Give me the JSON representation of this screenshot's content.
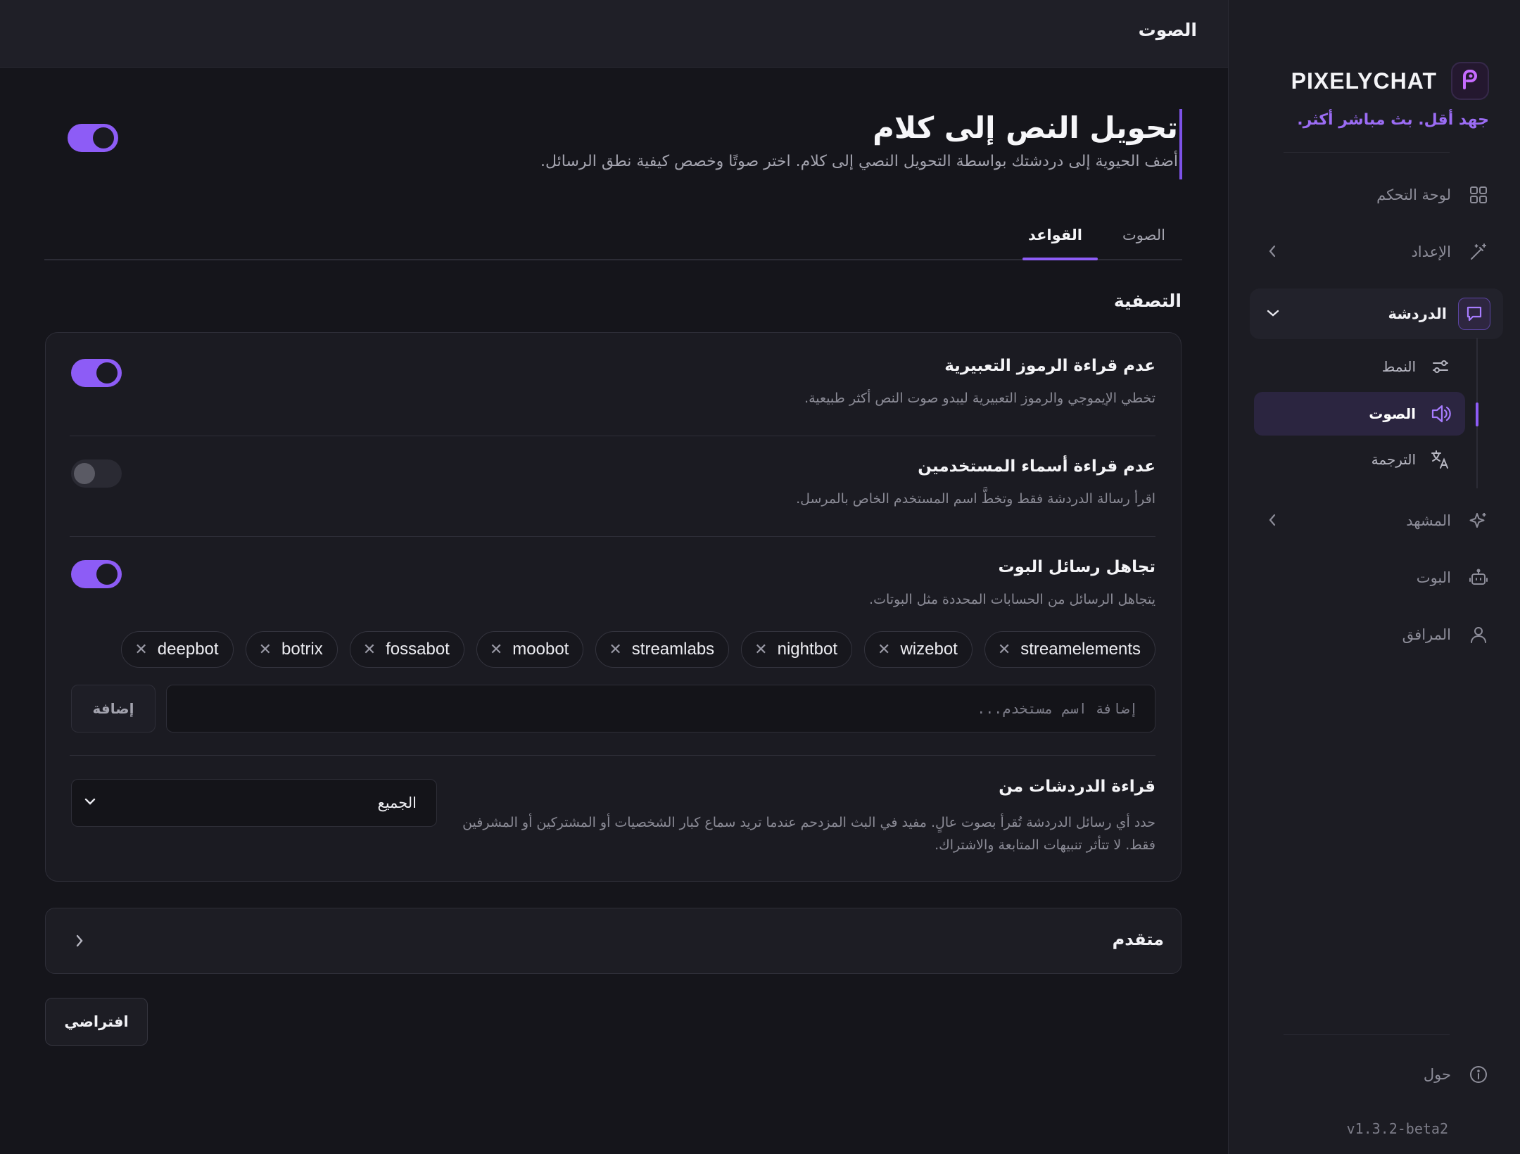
{
  "sidebar": {
    "brand": "PIXELYCHAT",
    "tagline": "جهد أقل. بث مباشر أكثر.",
    "items": [
      {
        "label": "لوحة التحكم",
        "icon": "grid-icon"
      },
      {
        "label": "الإعداد",
        "icon": "magic-wand-icon"
      },
      {
        "label": "الدردشة",
        "icon": "chat-bubble-icon"
      },
      {
        "label": "المشهد",
        "icon": "sparkles-icon"
      },
      {
        "label": "البوت",
        "icon": "robot-icon"
      },
      {
        "label": "المرافق",
        "icon": "user-icon"
      }
    ],
    "chat_subitems": [
      {
        "label": "النمط",
        "icon": "sliders-icon"
      },
      {
        "label": "الصوت",
        "icon": "speaker-icon"
      },
      {
        "label": "الترجمة",
        "icon": "translate-icon"
      }
    ],
    "about": "حول",
    "version": "v1.3.2-beta2"
  },
  "topbar": {
    "title": "الصوت"
  },
  "hero": {
    "title": "تحويل النص إلى كلام",
    "subtitle": "أضف الحيوية إلى دردشتك بواسطة التحويل النصي إلى كلام. اختر صوتًا وخصص كيفية نطق الرسائل.",
    "enabled": true
  },
  "tabs": [
    {
      "label": "الصوت",
      "active": false
    },
    {
      "label": "القواعد",
      "active": true
    }
  ],
  "filter": {
    "section_title": "التصفية",
    "rows": [
      {
        "title": "عدم قراءة الرموز التعبيرية",
        "description": "تخطي الإيموجي والرموز التعبيرية ليبدو صوت النص أكثر طبيعية.",
        "enabled": true
      },
      {
        "title": "عدم قراءة أسماء المستخدمين",
        "description": "اقرأ رسالة الدردشة فقط وتخطَّ اسم المستخدم الخاص بالمرسل.",
        "enabled": false
      },
      {
        "title": "تجاهل رسائل البوت",
        "description": "يتجاهل الرسائل من الحسابات المحددة مثل البوتات.",
        "enabled": true
      }
    ],
    "bots": [
      "streamelements",
      "wizebot",
      "nightbot",
      "streamlabs",
      "moobot",
      "fossabot",
      "botrix",
      "deepbot"
    ],
    "add_placeholder": "إضافة اسم مستخدم...",
    "add_button": "إضافة",
    "read_from": {
      "title": "قراءة الدردشات من",
      "description": "حدد أي رسائل الدردشة تُقرأ بصوت عالٍ. مفيد في البث المزدحم عندما تريد سماع كبار الشخصيات أو المشتركين أو المشرفين فقط. لا تتأثر تنبيهات المتابعة والاشتراك.",
      "selected": "الجميع"
    }
  },
  "advanced": {
    "title": "متقدم"
  },
  "default_button": "افتراضي",
  "colors": {
    "accent": "#8d5cf6",
    "background": "#15151b",
    "sidebar": "#1c1c23",
    "tagline": "#9b6cf4"
  }
}
